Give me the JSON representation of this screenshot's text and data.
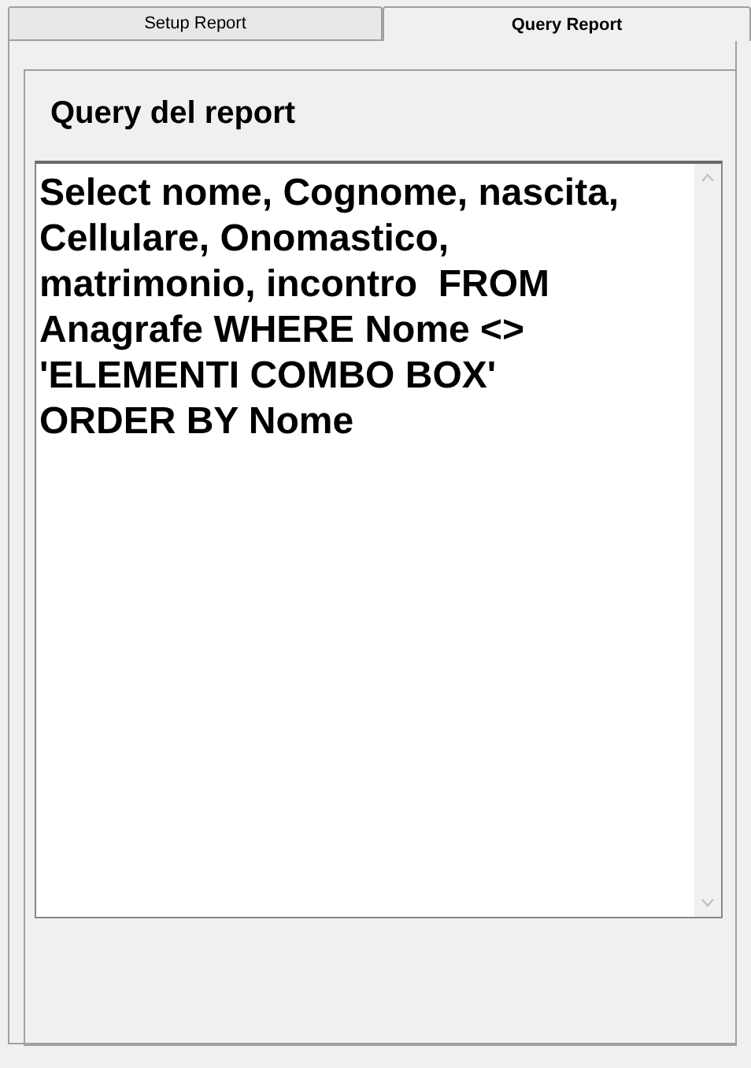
{
  "tabs": [
    {
      "label": "Setup Report",
      "selected": false
    },
    {
      "label": "Query Report",
      "selected": true
    }
  ],
  "panel": {
    "title": "Query del report",
    "query": "Select nome, Cognome, nascita, Cellulare, Onomastico, matrimonio, incontro  FROM Anagrafe WHERE Nome <> 'ELEMENTI COMBO BOX'                    ORDER BY Nome"
  }
}
